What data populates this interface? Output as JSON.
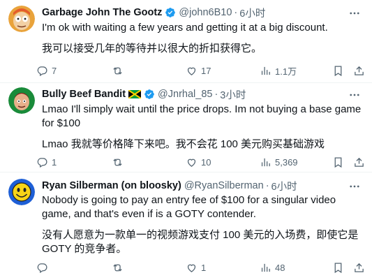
{
  "tweets": [
    {
      "name": "Garbage John The Gootz",
      "handle": "@john6B10",
      "separator": "·",
      "time": "6小时",
      "verified": true,
      "flag": false,
      "text": "I'm ok with waiting a few years and getting it at a big discount.",
      "translation": "我可以接受几年的等待并以很大的折扣获得它。",
      "replies": "7",
      "retweets": "",
      "likes": "17",
      "views": "1.1万",
      "avatar_icon": "cartoon-face-avatar"
    },
    {
      "name": "Bully Beef Bandit",
      "handle": "@Jnrhal_85",
      "separator": "·",
      "time": "3小时",
      "verified": true,
      "flag": true,
      "text": "Lmao I'll simply wait until the price drops. Im not buying a base game for $100",
      "translation": "Lmao 我就等价格降下来吧。我不会花 100 美元购买基础游戏",
      "replies": "1",
      "retweets": "",
      "likes": "10",
      "views": "5,369",
      "avatar_icon": "cartoon-person-avatar"
    },
    {
      "name": "Ryan Silberman (on bloosky)",
      "handle": "@RyanSilberman",
      "separator": "·",
      "time": "6小时",
      "verified": false,
      "flag": false,
      "text": "Nobody is going to pay an entry fee of $100 for a singular video game, and that's even if is a GOTY contender.",
      "translation": "没有人愿意为一款单一的视频游戏支付 100 美元的入场费，即使它是 GOTY 的竞争者。",
      "replies": "",
      "retweets": "",
      "likes": "1",
      "views": "48",
      "avatar_icon": "smiley-face-avatar"
    }
  ],
  "colors": {
    "text": "#0f1419",
    "secondary": "#536471",
    "verified": "#1d9bf0",
    "divider": "#eff3f4"
  },
  "icons": {
    "reply": "reply-icon",
    "retweet": "retweet-icon",
    "like": "heart-icon",
    "views": "views-chart-icon",
    "bookmark": "bookmark-icon",
    "share": "share-icon",
    "more": "more-options-icon"
  }
}
